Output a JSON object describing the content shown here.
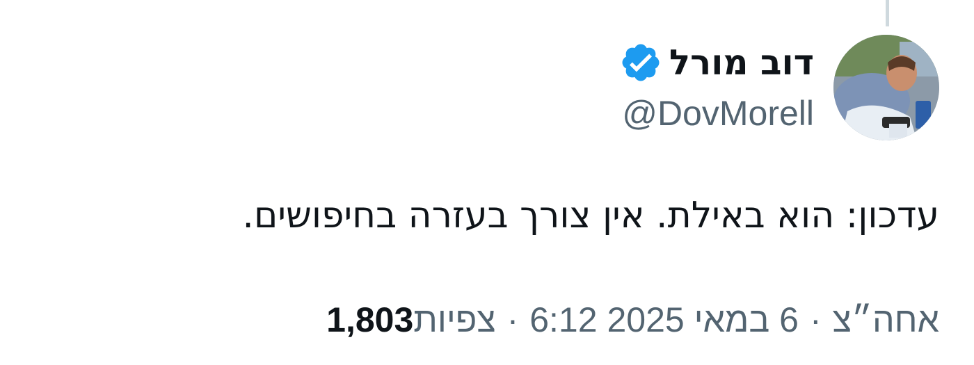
{
  "author": {
    "display_name": "דוב מורל",
    "handle": "@DovMorell",
    "verified": true,
    "verified_color": "#1d9bf0",
    "avatar_icon": "profile-photo"
  },
  "tweet": {
    "text": "עדכון: הוא באילת. אין צורך בעזרה בחיפושים."
  },
  "meta": {
    "time": "אחה״צ",
    "date": "6 במאי 2025",
    "clock": "6:12",
    "separator": "·",
    "views_count": "1,803",
    "views_label": "צפיות"
  }
}
